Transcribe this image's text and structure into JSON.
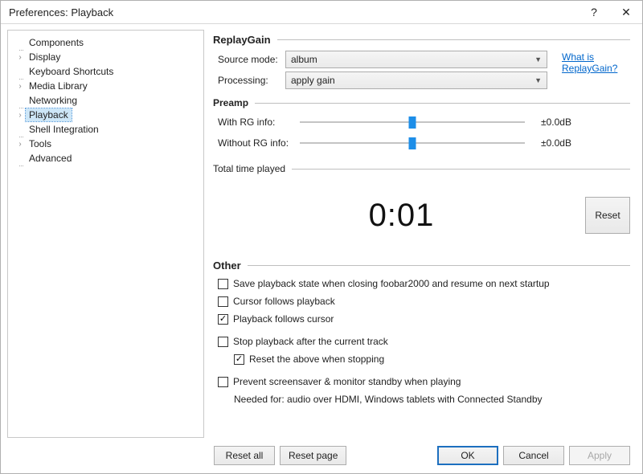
{
  "title": "Preferences: Playback",
  "titlebar": {
    "help_glyph": "?",
    "close_glyph": "✕"
  },
  "tree": [
    {
      "label": "Components",
      "caret": false
    },
    {
      "label": "Display",
      "caret": true
    },
    {
      "label": "Keyboard Shortcuts",
      "caret": false
    },
    {
      "label": "Media Library",
      "caret": true
    },
    {
      "label": "Networking",
      "caret": false
    },
    {
      "label": "Playback",
      "caret": true,
      "selected": true
    },
    {
      "label": "Shell Integration",
      "caret": false
    },
    {
      "label": "Tools",
      "caret": true
    },
    {
      "label": "Advanced",
      "caret": false
    }
  ],
  "sections": {
    "replaygain": "ReplayGain",
    "preamp": "Preamp",
    "totaltime": "Total time played",
    "other": "Other"
  },
  "replaygain": {
    "source_label": "Source mode:",
    "source_value": "album",
    "processing_label": "Processing:",
    "processing_value": "apply gain",
    "help_link": "What is ReplayGain?"
  },
  "preamp": {
    "with_label": "With RG info:",
    "with_value": "±0.0dB",
    "without_label": "Without RG info:",
    "without_value": "±0.0dB"
  },
  "totaltime": {
    "value": "0:01",
    "reset": "Reset"
  },
  "other": {
    "save_state": {
      "label": "Save playback state when closing foobar2000 and resume on next startup",
      "checked": false
    },
    "cursor_follows": {
      "label": "Cursor follows playback",
      "checked": false
    },
    "playback_follows": {
      "label": "Playback follows cursor",
      "checked": true
    },
    "stop_after": {
      "label": "Stop playback after the current track",
      "checked": false
    },
    "reset_above": {
      "label": "Reset the above when stopping",
      "checked": true
    },
    "prevent_screensaver": {
      "label": "Prevent screensaver & monitor standby when playing",
      "checked": false
    },
    "note": "Needed for: audio over HDMI, Windows tablets with Connected Standby"
  },
  "footer": {
    "reset_all": "Reset all",
    "reset_page": "Reset page",
    "ok": "OK",
    "cancel": "Cancel",
    "apply": "Apply"
  }
}
